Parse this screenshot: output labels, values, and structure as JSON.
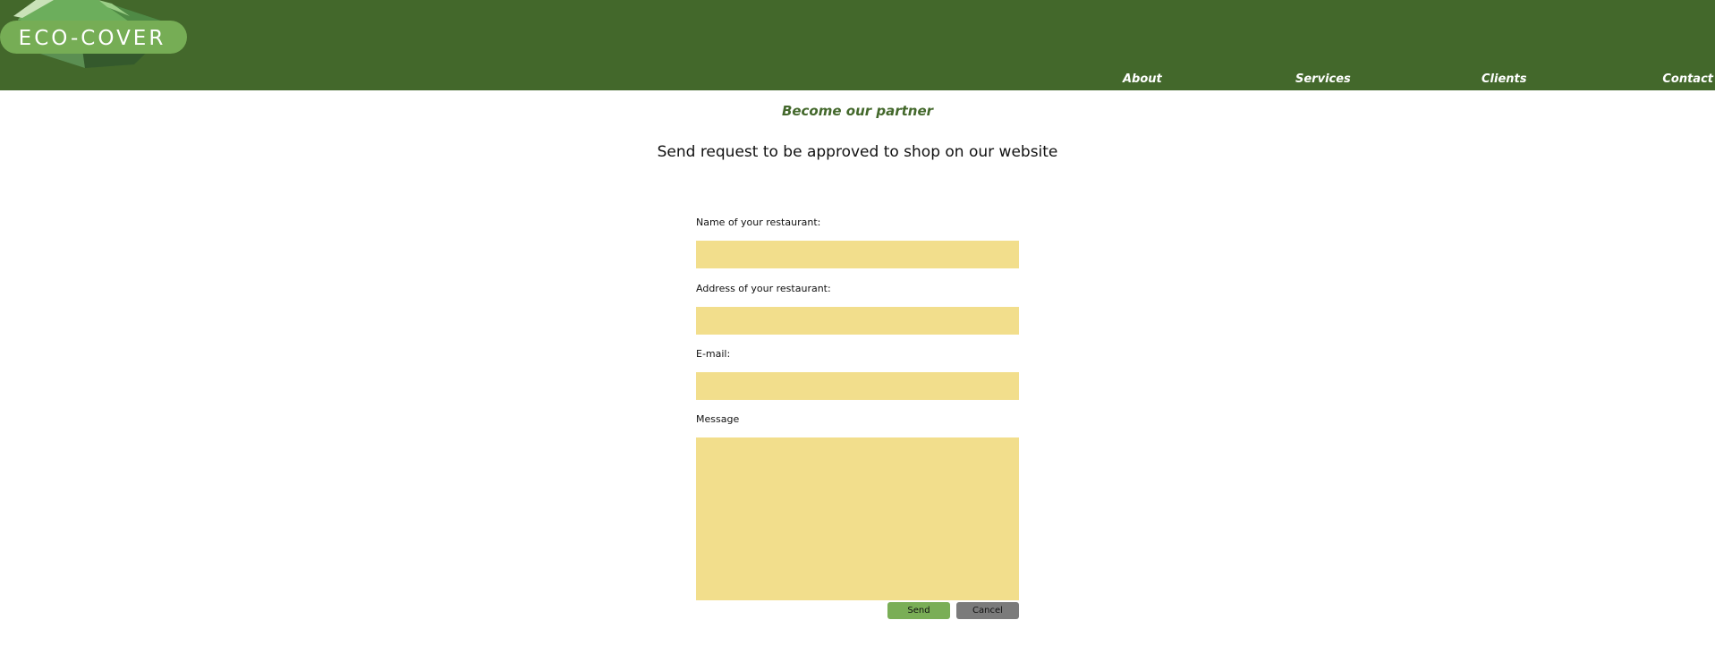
{
  "header": {
    "logo_text": "ECO-COVER",
    "background_color": "#43682b",
    "nav": [
      {
        "label": "About"
      },
      {
        "label": "Services"
      },
      {
        "label": "Clients"
      },
      {
        "label": "Contact"
      }
    ]
  },
  "main": {
    "title": "Become our partner",
    "subtitle": "Send request to be approved to shop on our website"
  },
  "form": {
    "fields": [
      {
        "label": "Name of your restaurant:",
        "value": ""
      },
      {
        "label": "Address of your restaurant:",
        "value": ""
      },
      {
        "label": "E-mail:",
        "value": ""
      },
      {
        "label": "Message",
        "value": ""
      }
    ],
    "input_color": "#f2de8c",
    "send_label": "Send",
    "send_color": "#7aae56",
    "cancel_label": "Cancel",
    "cancel_color": "#7b7b7b"
  }
}
